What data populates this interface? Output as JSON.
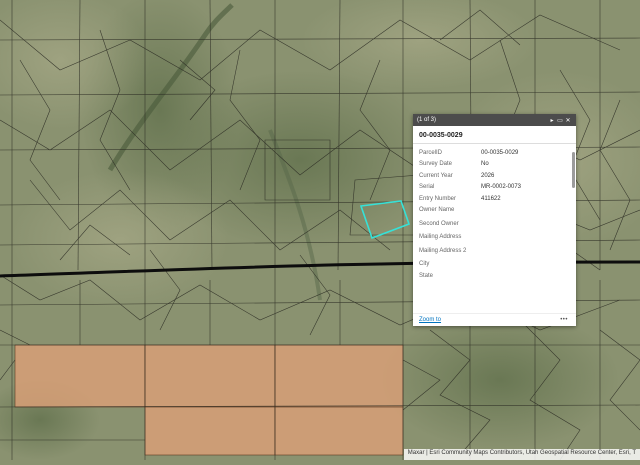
{
  "map": {
    "colors": {
      "terrain": "#8a9270",
      "highlight_fill": "#d79f77",
      "selected_parcel_outline": "#35e2d8",
      "parcel_line": "#2a2a22",
      "boundary_line": "#0d0d0d"
    },
    "road_labels": [
      "",
      "",
      "",
      "",
      "",
      "",
      "",
      ""
    ]
  },
  "popup": {
    "counter": "(1 of 3)",
    "controls": [
      "▸",
      "▭",
      "✕"
    ],
    "title": "00-0035-0029",
    "fields": [
      {
        "label": "ParcelID",
        "value": "00-0035-0029"
      },
      {
        "label": "Survey Date",
        "value": "No"
      },
      {
        "label": "Current Year",
        "value": "2026"
      },
      {
        "label": "Serial",
        "value": "MR-0002-0073"
      },
      {
        "label": "Entry Number",
        "value": "411622"
      },
      {
        "label": "Owner Name",
        "value": ""
      },
      {
        "label": "Second Owner",
        "value": ""
      },
      {
        "label": "Mailing Address",
        "value": ""
      },
      {
        "label": "Mailing Address 2",
        "value": ""
      },
      {
        "label": "City",
        "value": ""
      },
      {
        "label": "State",
        "value": ""
      }
    ],
    "zoom_label": "Zoom to",
    "more_label": "•••"
  },
  "attribution": "Maxar | Esri Community Maps Contributors, Utah Geospatial Resource Center, Esri, T"
}
